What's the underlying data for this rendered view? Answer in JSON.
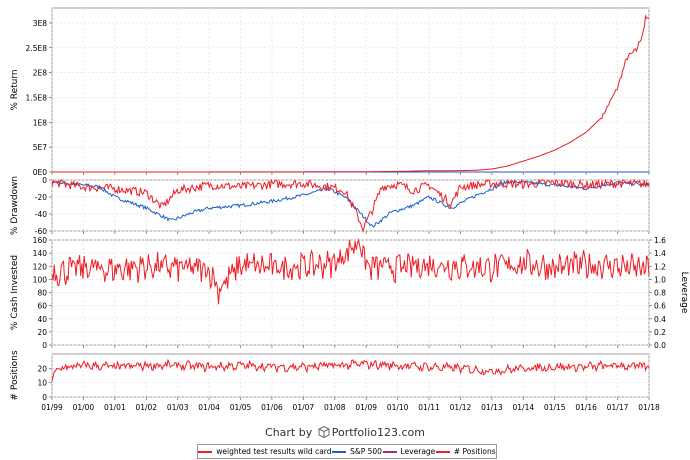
{
  "chart_data": [
    {
      "type": "line",
      "ylabel": "% Return",
      "yticks": [
        "0E0",
        "5E7",
        "1E8",
        "1.5E8",
        "2E8",
        "2.5E8",
        "3E8"
      ],
      "ylim": [
        0,
        330000000
      ],
      "grid": true,
      "series": [
        {
          "name": "weighted test results wild card",
          "color": "#ee1c24",
          "x": [
            1999.0,
            2003.0,
            2006.0,
            2008.0,
            2009.0,
            2010.0,
            2011.0,
            2011.5,
            2012.0,
            2012.5,
            2013.0,
            2013.5,
            2014.0,
            2014.5,
            2015.0,
            2015.5,
            2016.0,
            2016.5,
            2017.0,
            2017.3,
            2017.6,
            2017.8,
            2017.9,
            2018.0
          ],
          "y": [
            0,
            50000,
            200000,
            400000,
            600000,
            1200000,
            2600000,
            2600000,
            2800000,
            3500000,
            6000000,
            12000000,
            22000000,
            32000000,
            44000000,
            60000000,
            80000000,
            110000000,
            170000000,
            230000000,
            245000000,
            280000000,
            310000000,
            305000000
          ]
        },
        {
          "name": "S&P 500",
          "color": "#1f5fc4",
          "x": [
            1999.0,
            2018.0
          ],
          "y": [
            0,
            0
          ]
        }
      ]
    },
    {
      "type": "line",
      "ylabel": "% Drawdown",
      "yticks": [
        "0",
        "-20",
        "-40",
        "-60"
      ],
      "ylim": [
        -60,
        0
      ],
      "grid": true,
      "series": [
        {
          "name": "weighted test results wild card",
          "color": "#ee1c24",
          "x": [
            1999.0,
            2000.0,
            2001.0,
            2002.0,
            2002.5,
            2003.0,
            2004.0,
            2005.0,
            2006.0,
            2007.0,
            2007.8,
            2008.3,
            2008.7,
            2008.9,
            2009.2,
            2009.5,
            2010.0,
            2010.5,
            2011.0,
            2011.7,
            2012.0,
            2013.0,
            2014.0,
            2015.0,
            2016.0,
            2017.0,
            2018.0
          ],
          "y": [
            -3,
            -8,
            -10,
            -15,
            -32,
            -12,
            -6,
            -8,
            -5,
            -4,
            -8,
            -12,
            -40,
            -57,
            -35,
            -8,
            -5,
            -12,
            -6,
            -28,
            -8,
            -4,
            -5,
            -3,
            -6,
            -4,
            -5
          ]
        },
        {
          "name": "S&P 500",
          "color": "#1f5fc4",
          "x": [
            1999.0,
            2000.5,
            2001.0,
            2002.0,
            2002.8,
            2003.5,
            2004.0,
            2005.0,
            2006.0,
            2007.0,
            2007.8,
            2008.4,
            2009.2,
            2009.8,
            2010.5,
            2011.0,
            2011.7,
            2012.5,
            2013.0,
            2013.5,
            2014.0,
            2015.0,
            2016.0,
            2017.0,
            2018.0
          ],
          "y": [
            -2,
            -8,
            -20,
            -33,
            -48,
            -38,
            -33,
            -30,
            -25,
            -18,
            -10,
            -22,
            -55,
            -38,
            -30,
            -20,
            -33,
            -18,
            -10,
            -2,
            -3,
            -6,
            -10,
            -3,
            -6
          ]
        }
      ]
    },
    {
      "type": "line",
      "ylabel": "% Cash Invested",
      "y2label": "Leverage",
      "yticks": [
        "0",
        "20",
        "40",
        "60",
        "80",
        "100",
        "120",
        "140",
        "160"
      ],
      "y2ticks": [
        "0.0",
        "0.2",
        "0.4",
        "0.6",
        "0.8",
        "1.0",
        "1.2",
        "1.4",
        "1.6"
      ],
      "ylim": [
        0,
        160
      ],
      "y2lim": [
        0,
        1.6
      ],
      "grid": true,
      "series": [
        {
          "name": "Leverage",
          "color": "#ee1c24",
          "x": [
            1999.0,
            2000.0,
            2001.0,
            2002.0,
            2003.0,
            2004.0,
            2004.3,
            2005.0,
            2006.0,
            2007.0,
            2008.0,
            2008.8,
            2009.0,
            2010.0,
            2011.0,
            2012.0,
            2013.0,
            2014.0,
            2015.0,
            2016.0,
            2017.0,
            2018.0
          ],
          "y": [
            110,
            118,
            115,
            120,
            118,
            115,
            85,
            122,
            118,
            120,
            125,
            160,
            120,
            118,
            122,
            120,
            118,
            125,
            118,
            122,
            120,
            115
          ]
        }
      ]
    },
    {
      "type": "line",
      "ylabel": "# Positions",
      "yticks": [
        "0",
        "10",
        "20"
      ],
      "ylim": [
        0,
        30
      ],
      "grid": true,
      "series": [
        {
          "name": "# Positions",
          "color": "#ee1c24",
          "x": [
            1999.0,
            1999.2,
            2000.0,
            2001.0,
            2002.0,
            2003.0,
            2004.0,
            2005.0,
            2006.0,
            2007.0,
            2008.0,
            2009.0,
            2010.0,
            2011.0,
            2012.0,
            2013.0,
            2014.0,
            2015.0,
            2016.0,
            2017.0,
            2018.0
          ],
          "y": [
            12,
            20,
            22,
            21,
            22,
            22,
            21,
            22,
            21,
            21,
            22,
            23,
            22,
            21,
            20,
            18,
            20,
            21,
            21,
            22,
            21
          ]
        }
      ]
    }
  ],
  "x_axis": {
    "labels": [
      "01/99",
      "01/00",
      "01/01",
      "01/02",
      "01/03",
      "01/04",
      "01/05",
      "01/06",
      "01/07",
      "01/08",
      "01/09",
      "01/10",
      "01/11",
      "01/12",
      "01/13",
      "01/14",
      "01/15",
      "01/16",
      "01/17",
      "01/18"
    ],
    "range": [
      1999.0,
      2018.0
    ]
  },
  "footer": {
    "text_before": "Chart by",
    "brand": "Portfolio123.com"
  },
  "legend": [
    {
      "label": "weighted test results wild card",
      "color": "#ee1c24"
    },
    {
      "label": "S&P 500",
      "color": "#1f5fc4"
    },
    {
      "label": "Leverage",
      "color": "#9b2f7a"
    },
    {
      "label": "# Positions",
      "color": "#ee1c24"
    }
  ]
}
